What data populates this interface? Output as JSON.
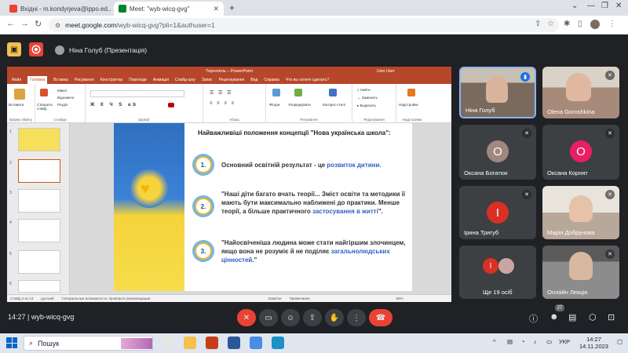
{
  "browser": {
    "tabs": [
      {
        "title": "Вхідні - m.kondyrjeva@ippo.ed...",
        "active": false
      },
      {
        "title": "Meet: \"wyb-wicq-gvg\"",
        "active": true
      }
    ],
    "url_host": "meet.google.com",
    "url_path": "/wyb-wicq-gvg?pli=1&authuser=1"
  },
  "meet": {
    "presenter_chip": "Ніна Голуб (Презентація)",
    "meeting_code": "wyb-wicq-gvg",
    "time": "14:27",
    "participant_count": "27"
  },
  "powerpoint": {
    "window_title": "Тернопіль – PowerPoint",
    "user_label": "User User",
    "menu": [
      "Файл",
      "Головна",
      "Вставка",
      "Рисування",
      "Конструктор",
      "Переходи",
      "Анімація",
      "Слайд-шоу",
      "Запис",
      "Рецензування",
      "Вид",
      "Справка",
      "Что вы хотите сделать?"
    ],
    "ribbon_groups": [
      "Буфер обміну",
      "Слайди",
      "Шрифт",
      "Абзац",
      "Рисування",
      "Редагування",
      "Надстройки"
    ],
    "ribbon_labels": {
      "paste": "Вставити",
      "new_slide": "Створити слайд",
      "layout": "Макет",
      "reset": "Відновити",
      "section": "Розділ",
      "shapes": "Фігури",
      "arrange": "Упорядкувати",
      "styles": "Експрес-стилі",
      "find": "Найти",
      "replace": "Заменить",
      "select": "Выделить",
      "addins": "Надстройки"
    },
    "status": {
      "slide": "Слайд 2 из 13",
      "lang": "русский",
      "accessibility": "Специальные возможности: проверьте рекомендации",
      "notes": "Заметки",
      "comments": "Примечания",
      "zoom": "66%"
    },
    "slide": {
      "title": "Найважливіші положення концепції \"Нова українська школа\":",
      "points": [
        {
          "num": "1.",
          "text_before": "Основний освітній результат - це ",
          "highlight": "розвиток дитини.",
          "text_after": ""
        },
        {
          "num": "2.",
          "text_before": "\"Наші діти багато вчать теорії... Зміст освіти та методики її мають бути максимально наближені до практики. Менше теорії, а більше практичного ",
          "highlight": "застосування в житті",
          "text_after": "\"."
        },
        {
          "num": "3.",
          "text_before": "\"Найосвіченіша людина може стати найгіршим злочинцем, якщо вона не розуміє й не поділяє ",
          "highlight": "загальнолюдських цінностей",
          "text_after": ".\""
        }
      ]
    }
  },
  "participants": [
    {
      "name": "Ніна Голуб",
      "kind": "photo",
      "color": "#7a6a5e"
    },
    {
      "name": "Olena Goroshkina",
      "kind": "photo",
      "color": "#a88a7a"
    },
    {
      "name": "Оксана Богатюк",
      "kind": "initial",
      "initial": "O",
      "color": "#a1887f"
    },
    {
      "name": "Оксана Корнят",
      "kind": "initial",
      "initial": "O",
      "color": "#e91e63"
    },
    {
      "name": "Ірина Тригуб",
      "kind": "initial",
      "initial": "I",
      "color": "#d93025"
    },
    {
      "name": "Марія Добрунова",
      "kind": "photo",
      "color": "#b8a89a"
    },
    {
      "name": "Ще 19 осіб",
      "kind": "more",
      "initial": "I",
      "color": "#d93025"
    },
    {
      "name": "Онлайн Лекція",
      "kind": "photo",
      "color": "#8c8c8c"
    }
  ],
  "taskbar": {
    "search": "Пошук",
    "lang": "УКР",
    "time": "14:27",
    "date": "14.11.2023"
  }
}
